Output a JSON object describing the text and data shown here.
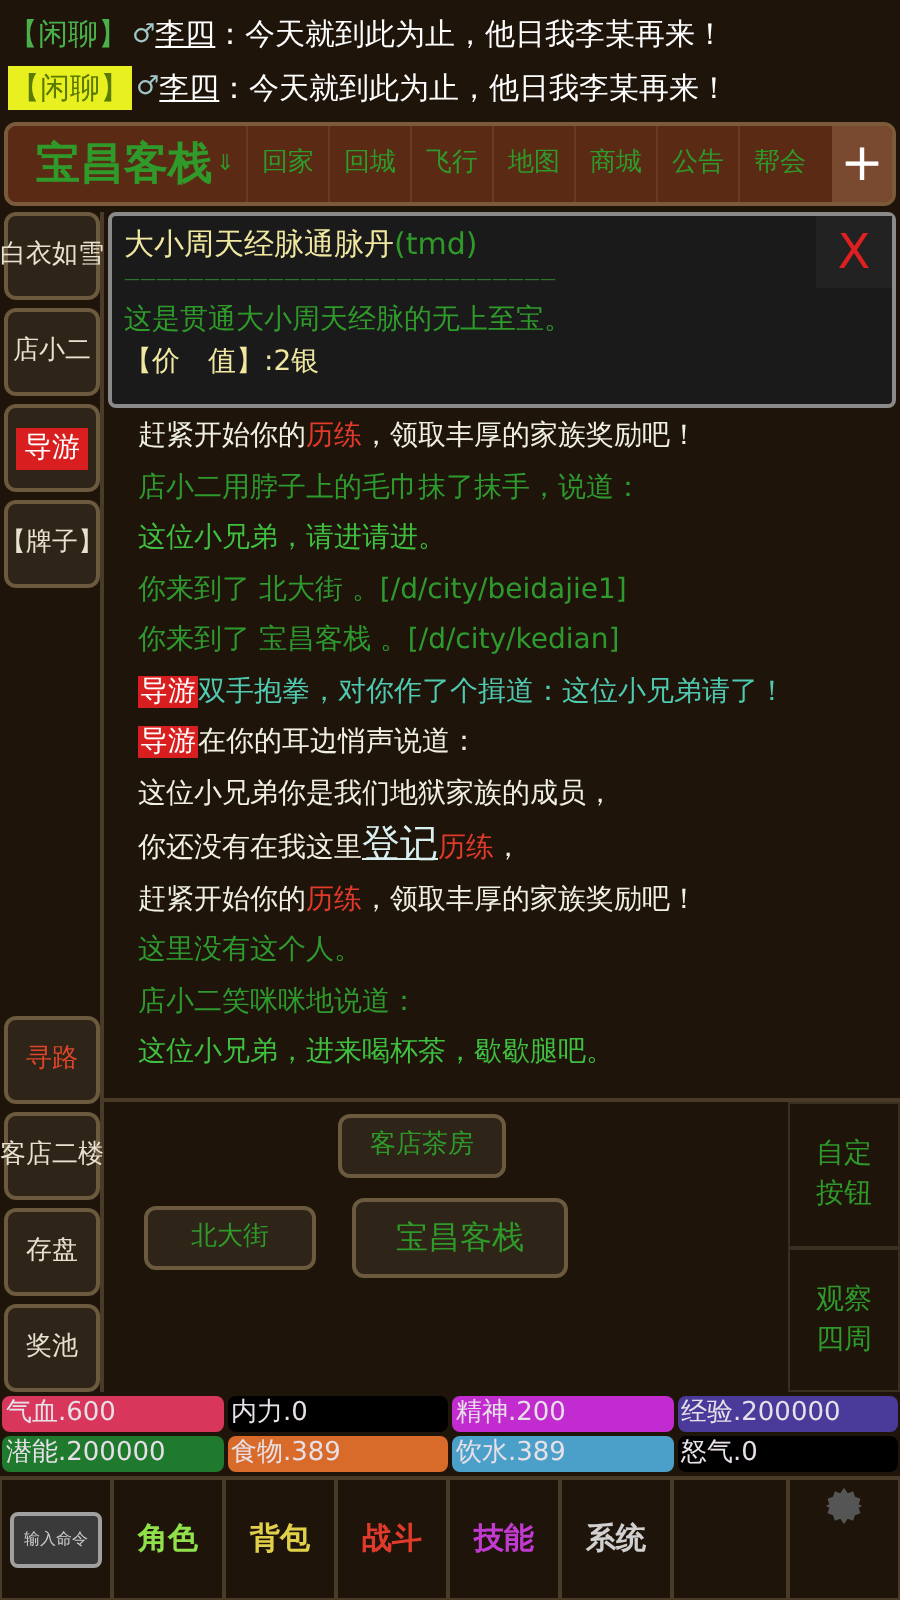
{
  "chat": [
    {
      "channel": "【闲聊】",
      "highlighted": false,
      "gender": "♂",
      "speaker": "李四",
      "message": "：今天就到此为止，他日我李某再来！"
    },
    {
      "channel": "【闲聊】",
      "highlighted": true,
      "gender": "♂",
      "speaker": "李四",
      "message": "：今天就到此为止，他日我李某再来！"
    }
  ],
  "nav": {
    "location": "宝昌客栈",
    "marker": "⇓",
    "items": [
      "回家",
      "回城",
      "飞行",
      "地图",
      "商城",
      "公告",
      "帮会"
    ],
    "add": "+"
  },
  "side_top": [
    {
      "label": "白衣如雪",
      "kind": "plain"
    },
    {
      "label": "店小二",
      "kind": "plain"
    },
    {
      "label": "导游",
      "kind": "tag"
    },
    {
      "label": "【牌子】",
      "kind": "plain"
    }
  ],
  "side_bottom": [
    {
      "label": "寻路",
      "kind": "route"
    },
    {
      "label": "客店二楼",
      "kind": "plain"
    },
    {
      "label": "存盘",
      "kind": "plain"
    },
    {
      "label": "奖池",
      "kind": "plain"
    }
  ],
  "item_popup": {
    "name": "大小周天经脉通脉丹",
    "code": "(tmd)",
    "divider": "———————————————————————————",
    "description": "这是贯通大小周天经脉的无上至宝。",
    "price_label": "【价　值】",
    "price": ":2银",
    "close": "X"
  },
  "log": [
    {
      "segments": [
        {
          "text": "赶紧开始你的",
          "kind": "normal"
        },
        {
          "text": "历练",
          "kind": "keyword"
        },
        {
          "text": "，领取丰厚的家族奖励吧！",
          "kind": "normal"
        }
      ]
    },
    {
      "segments": [
        {
          "text": "店小二用脖子上的毛巾抹了抹手，说道：",
          "kind": "event"
        }
      ]
    },
    {
      "segments": [
        {
          "text": "这位小兄弟，请进请进。",
          "kind": "speech"
        }
      ]
    },
    {
      "segments": [
        {
          "text": "你来到了 北大街 。[/d/city/beidajie1]",
          "kind": "event"
        }
      ]
    },
    {
      "segments": [
        {
          "text": "你来到了 宝昌客栈 。[/d/city/kedian]",
          "kind": "event"
        }
      ]
    },
    {
      "segments": [
        {
          "text": "导游",
          "kind": "tag"
        },
        {
          "text": "双手抱拳，对你作了个揖道：这位小兄弟请了！",
          "kind": "action"
        }
      ]
    },
    {
      "segments": [
        {
          "text": "导游",
          "kind": "tag"
        },
        {
          "text": "在你的耳边悄声说道：",
          "kind": "normal"
        }
      ]
    },
    {
      "segments": [
        {
          "text": "这位小兄弟你是我们地狱家族的成员，",
          "kind": "normal"
        }
      ]
    },
    {
      "segments": [
        {
          "text": "你还没有在我这里",
          "kind": "normal"
        },
        {
          "text": "登记",
          "kind": "link"
        },
        {
          "text": "历练",
          "kind": "keyword"
        },
        {
          "text": "，",
          "kind": "normal"
        }
      ]
    },
    {
      "segments": [
        {
          "text": "赶紧开始你的",
          "kind": "normal"
        },
        {
          "text": "历练",
          "kind": "keyword"
        },
        {
          "text": "，领取丰厚的家族奖励吧！",
          "kind": "normal"
        }
      ]
    },
    {
      "segments": [
        {
          "text": "这里没有这个人。",
          "kind": "event"
        }
      ]
    },
    {
      "segments": [
        {
          "text": "店小二笑咪咪地说道：",
          "kind": "event"
        }
      ]
    },
    {
      "segments": [
        {
          "text": "这位小兄弟，进来喝杯茶，歇歇腿吧。",
          "kind": "speech"
        }
      ]
    }
  ],
  "map": {
    "north": "客店茶房",
    "west": "北大街",
    "current": "宝昌客栈"
  },
  "side_right": [
    "自定按钮",
    "观察四周"
  ],
  "stats": [
    {
      "label": "气血.600",
      "color": "#d8365a"
    },
    {
      "label": "内力.0",
      "color": "#000000"
    },
    {
      "label": "精神.200",
      "color": "#c22bd0"
    },
    {
      "label": "经验.200000",
      "color": "#4a3a9a"
    },
    {
      "label": "潜能.200000",
      "color": "#1f7a2e"
    },
    {
      "label": "食物.389",
      "color": "#d86a2a"
    },
    {
      "label": "饮水.389",
      "color": "#4aa0c8"
    },
    {
      "label": "怒气.0",
      "color": "#000000"
    }
  ],
  "input_button": "输入命令",
  "tabs": [
    {
      "label": "角色",
      "color": "#8fe04a"
    },
    {
      "label": "背包",
      "color": "#e0d04a"
    },
    {
      "label": "战斗",
      "color": "#e03a2a"
    },
    {
      "label": "技能",
      "color": "#c23ad0"
    },
    {
      "label": "系统",
      "color": "#d0d0d0"
    }
  ]
}
